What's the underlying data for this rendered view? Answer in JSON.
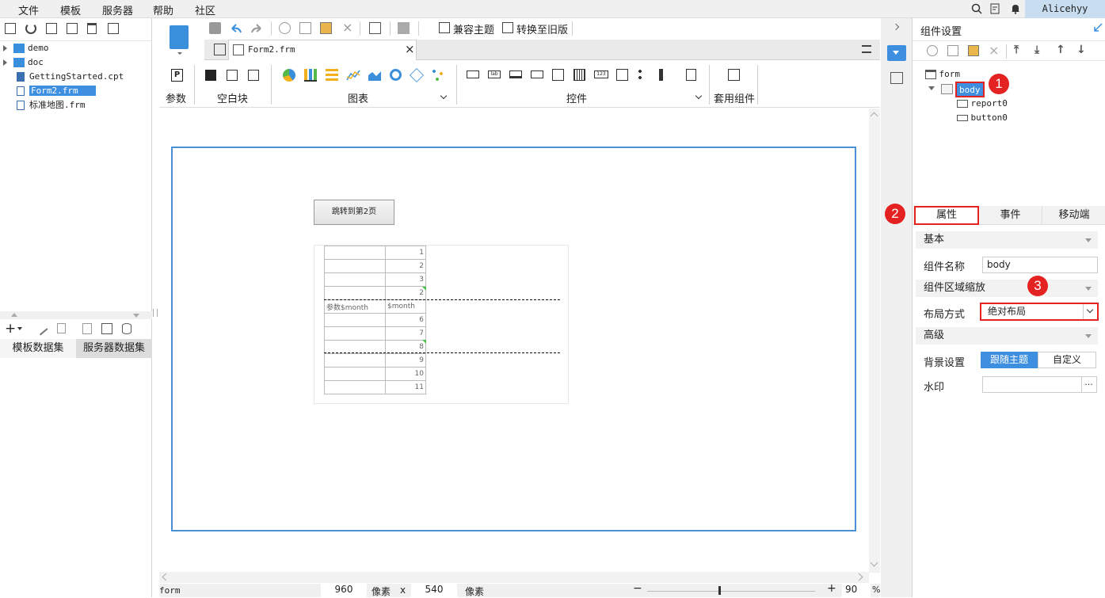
{
  "menubar": {
    "items": [
      "文件",
      "模板",
      "服务器",
      "帮助",
      "社区"
    ],
    "user": "Alicehyy"
  },
  "file_tree": {
    "items": [
      {
        "label": "demo",
        "type": "folder"
      },
      {
        "label": "doc",
        "type": "folder"
      },
      {
        "label": "GettingStarted.cpt",
        "type": "cpt"
      },
      {
        "label": "Form2.frm",
        "type": "frm",
        "selected": true
      },
      {
        "label": "标准地图.frm",
        "type": "frm"
      }
    ]
  },
  "dataset_tabs": [
    "模板数据集",
    "服务器数据集"
  ],
  "toolbar": {
    "compat_theme": "兼容主题",
    "convert_old": "转换至旧版"
  },
  "tab": {
    "title": "Form2.frm"
  },
  "ribbon": {
    "param": "参数",
    "blank": "空白块",
    "chart": "图表",
    "control": "控件",
    "suite": "套用组件"
  },
  "canvas": {
    "button_label": "跳转到第2页",
    "table_rows": [
      {
        "a": "",
        "b": "1"
      },
      {
        "a": "",
        "b": "2"
      },
      {
        "a": "",
        "b": "3"
      },
      {
        "a": "",
        "b": "2"
      },
      {
        "a": "参数$month",
        "b": "$month"
      },
      {
        "a": "",
        "b": "6"
      },
      {
        "a": "",
        "b": "7"
      },
      {
        "a": "",
        "b": "8"
      },
      {
        "a": "",
        "b": "9"
      },
      {
        "a": "",
        "b": "10"
      },
      {
        "a": "",
        "b": "11"
      }
    ]
  },
  "statusbar": {
    "name": "form",
    "width": "960",
    "px1": "像素",
    "x": "x",
    "height": "540",
    "px2": "像素",
    "zoom": "90",
    "pct": "%"
  },
  "right": {
    "title": "组件设置",
    "tree": {
      "root": "form",
      "body": "body",
      "children": [
        "report0",
        "button0"
      ]
    },
    "tabs": [
      "属性",
      "事件",
      "移动端"
    ],
    "section_basic": "基本",
    "name_label": "组件名称",
    "name_value": "body",
    "section_zoom": "组件区域缩放",
    "layout_label": "布局方式",
    "layout_value": "绝对布局",
    "section_adv": "高级",
    "bg_label": "背景设置",
    "bg_opt1": "跟随主题",
    "bg_opt2": "自定义",
    "watermark_label": "水印",
    "watermark_btn": "···"
  },
  "badges": [
    "1",
    "2",
    "3"
  ],
  "colors": {
    "accent": "#4a90d9",
    "badge": "#e52222",
    "selected": "#3f8fe0",
    "highlight_box": "#e52222"
  }
}
